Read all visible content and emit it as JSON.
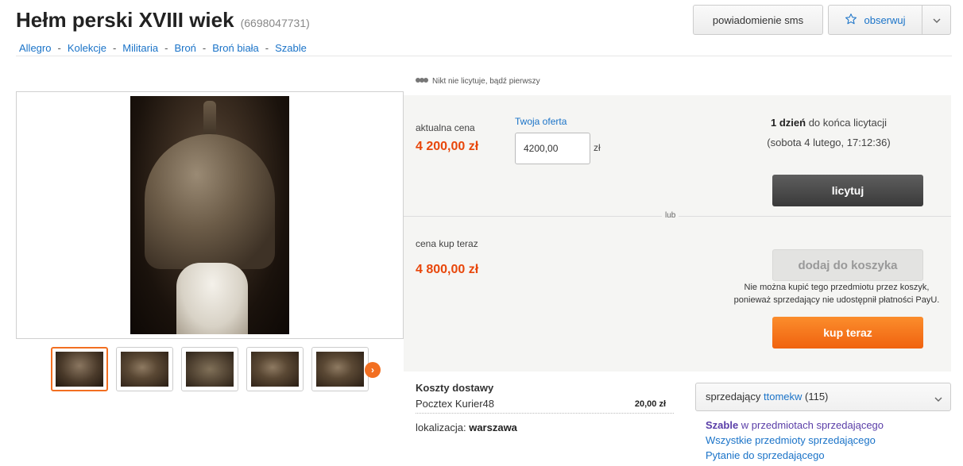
{
  "header": {
    "title": "Hełm perski XVIII wiek",
    "item_id": "(6698047731)",
    "sms_button": "powiadomienie sms",
    "watch_button": "obserwuj"
  },
  "breadcrumb": [
    "Allegro",
    "Kolekcje",
    "Militaria",
    "Broń",
    "Broń biała",
    "Szable"
  ],
  "gallery": {
    "thumbnail_count": 5,
    "active_index": 0
  },
  "auction": {
    "bids_note": "Nikt nie licytuje, bądź pierwszy",
    "current_price_label": "aktualna cena",
    "current_price": "4 200,00 zł",
    "offer_label": "Twoja oferta",
    "offer_value": "4200,00",
    "currency": "zł",
    "time_left_bold": "1 dzień",
    "time_left_rest": " do końca licytacji",
    "end_date": "(sobota 4 lutego, 17:12:36)",
    "bid_button": "licytuj",
    "or_label": "lub",
    "buy_now_label": "cena kup teraz",
    "buy_now_price": "4 800,00 zł",
    "cart_button": "dodaj do koszyka",
    "cart_note_line1": "Nie można kupić tego przedmiotu przez koszyk,",
    "cart_note_line2": "ponieważ sprzedający nie udostępnił płatności PayU.",
    "buy_button": "kup teraz"
  },
  "shipping": {
    "title": "Koszty dostawy",
    "method": "Pocztex Kurier48",
    "amount": "20,00 zł",
    "location_label": "lokalizacja: ",
    "location_value": "warszawa"
  },
  "seller": {
    "label": "sprzedający ",
    "name": "ttomekw",
    "rating": " (115)",
    "link1_strong": "Szable",
    "link1_rest": " w przedmiotach sprzedającego",
    "link2": "Wszystkie przedmioty sprzedającego",
    "link3": "Pytanie do sprzedającego"
  },
  "colors": {
    "accent_orange": "#f26f21",
    "price_red": "#e8470b",
    "link_blue": "#1a73c8"
  }
}
